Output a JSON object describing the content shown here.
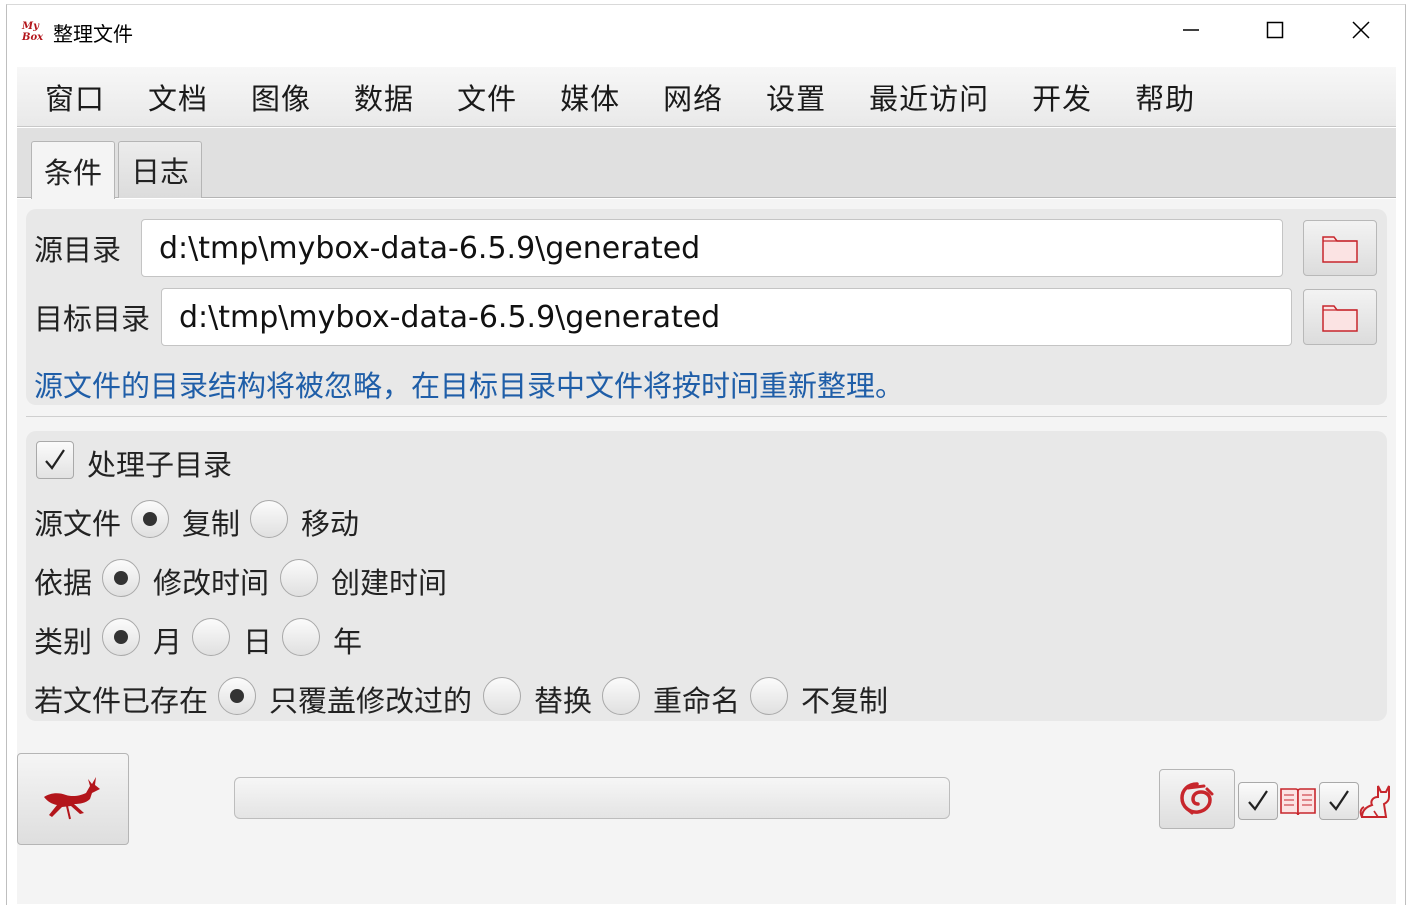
{
  "window": {
    "title": "整理文件",
    "app_icon_text": "MyBox",
    "controls": [
      "minimize",
      "maximize",
      "close"
    ]
  },
  "menu": {
    "items": [
      "窗口",
      "文档",
      "图像",
      "数据",
      "文件",
      "媒体",
      "网络",
      "设置",
      "最近访问",
      "开发",
      "帮助"
    ]
  },
  "tabs": [
    {
      "label": "条件",
      "active": true
    },
    {
      "label": "日志",
      "active": false
    }
  ],
  "source_dir": {
    "label": "源目录",
    "value": "d:\\tmp\\mybox-data-6.5.9\\generated"
  },
  "target_dir": {
    "label": "目标目录",
    "value": "d:\\tmp\\mybox-data-6.5.9\\generated"
  },
  "hint": "源文件的目录结构将被忽略，在目标目录中文件将按时间重新整理。",
  "options": {
    "subdir": {
      "label": "处理子目录",
      "checked": true
    },
    "source_file": {
      "label": "源文件",
      "choices": [
        "复制",
        "移动"
      ],
      "selected": "复制"
    },
    "basis": {
      "label": "依据",
      "choices": [
        "修改时间",
        "创建时间"
      ],
      "selected": "修改时间"
    },
    "category": {
      "label": "类别",
      "choices": [
        "月",
        "日",
        "年"
      ],
      "selected": "月"
    },
    "if_exists": {
      "label": "若文件已存在",
      "choices": [
        "只覆盖修改过的",
        "替换",
        "重命名",
        "不复制"
      ],
      "selected": "只覆盖修改过的"
    }
  },
  "progress": 0,
  "colors": {
    "accent_red": "#b3151b",
    "hint_blue": "#1f5ea8"
  },
  "icons": {
    "run": "running-deer-icon",
    "folder": "folder-icon",
    "netease": "netease-logo-icon",
    "book": "book-icon",
    "cat": "cat-icon"
  }
}
